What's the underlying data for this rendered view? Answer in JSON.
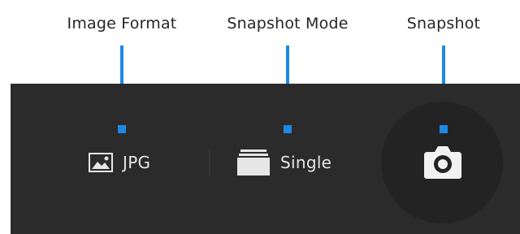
{
  "callouts": {
    "image_format": "Image Format",
    "snapshot_mode": "Snapshot Mode",
    "snapshot": "Snapshot"
  },
  "toolbar": {
    "format_value": "JPG",
    "mode_value": "Single",
    "format_icon": "image-icon",
    "mode_icon": "stack-icon",
    "snapshot_icon": "camera-icon"
  },
  "colors": {
    "callout": "#1e88e5",
    "toolbar_bg": "#2b2b2b",
    "snapshot_bg": "#232323",
    "text": "#e6e6e6"
  }
}
